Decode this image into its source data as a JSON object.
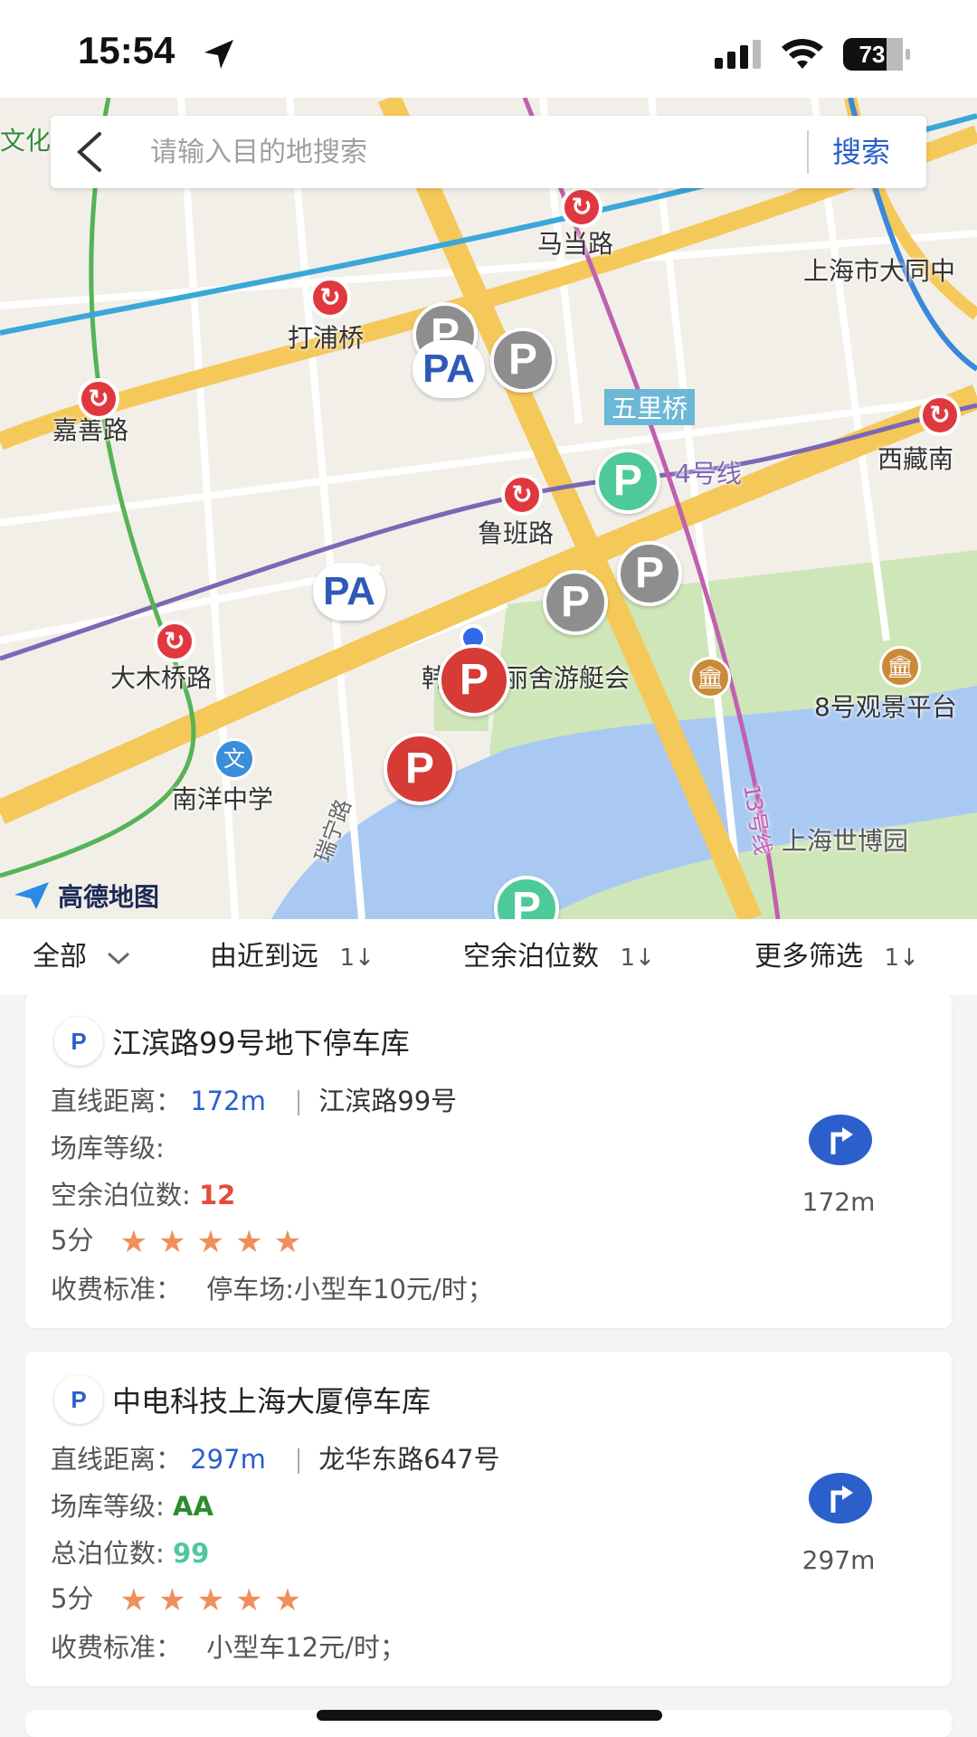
{
  "status_bar": {
    "time": "15:54",
    "battery": "73"
  },
  "search": {
    "placeholder": "请输入目的地搜索",
    "button_label": "搜索"
  },
  "map": {
    "brand": "高德地图",
    "labels": {
      "wenhua": "文化",
      "madang_road": "马当路",
      "dapuqiao": "打浦桥",
      "shanghai_datong": "上海市大同中",
      "jiashan_road": "嘉善路",
      "wuliqiao": "五里桥",
      "line4": "4号线",
      "xizang_south": "西藏南",
      "luban_road": "鲁班路",
      "damuqiao_road": "大木桥路",
      "hanyulishe": "韩",
      "jiangbin_yacht": "丽舍游艇会",
      "viewing_8": "8号观景平台",
      "nanyang_middle_school": "南洋中学",
      "ruining_road": "瑞宁路",
      "line13": "13号线",
      "expo_park": "上海世博园"
    },
    "pin_letter": "P",
    "pa_letter": "PA"
  },
  "filters": {
    "all": "全部",
    "near_to_far": "由近到远",
    "free_spaces": "空余泊位数",
    "more": "更多筛选",
    "sort_symbol": "1↓"
  },
  "parking_list": [
    {
      "badge": "P",
      "name": "江滨路99号地下停车库",
      "distance_label": "直线距离：",
      "distance": "172m",
      "address": "江滨路99号",
      "grade_label": "场库等级:",
      "grade": "",
      "spaces_label": "空余泊位数:",
      "spaces": "12",
      "score": "5分",
      "stars": 5,
      "fee_label": "收费标准：",
      "fee": "停车场:小型车10元/时；",
      "nav_distance": "172m"
    },
    {
      "badge": "P",
      "name": "中电科技上海大厦停车库",
      "distance_label": "直线距离：",
      "distance": "297m",
      "address": "龙华东路647号",
      "grade_label": "场库等级:",
      "grade": "AA",
      "spaces_label": "总泊位数:",
      "spaces": "99",
      "score": "5分",
      "stars": 5,
      "fee_label": "收费标准：",
      "fee": "小型车12元/时；",
      "nav_distance": "297m"
    }
  ],
  "colors": {
    "accent_blue": "#2b5fcc",
    "pin_red": "#d63b35",
    "pin_green": "#4ec99a",
    "pin_grey": "#8e8e8e",
    "star_orange": "#ef8f5c"
  }
}
